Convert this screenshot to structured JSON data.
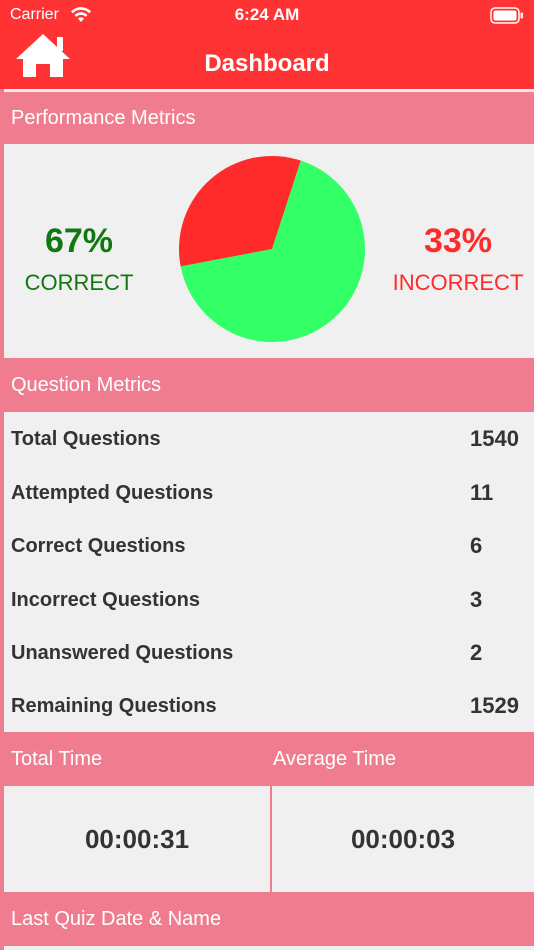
{
  "status_bar": {
    "carrier": "Carrier",
    "time": "6:24 AM"
  },
  "nav": {
    "title": "Dashboard",
    "home_icon": "home-icon"
  },
  "performance": {
    "header": "Performance Metrics",
    "correct_pct": "67%",
    "correct_label": "CORRECT",
    "incorrect_pct": "33%",
    "incorrect_label": "INCORRECT"
  },
  "question_metrics": {
    "header": "Question Metrics",
    "rows": [
      {
        "label": "Total Questions",
        "value": "1540"
      },
      {
        "label": "Attempted Questions",
        "value": "11"
      },
      {
        "label": "Correct Questions",
        "value": "6"
      },
      {
        "label": "Incorrect Questions",
        "value": "3"
      },
      {
        "label": "Unanswered Questions",
        "value": "2"
      },
      {
        "label": "Remaining Questions",
        "value": "1529"
      }
    ]
  },
  "time": {
    "total_header": "Total Time",
    "average_header": "Average Time",
    "total_value": "00:00:31",
    "average_value": "00:00:03"
  },
  "last_quiz": {
    "header": "Last Quiz Date & Name"
  },
  "chart_data": {
    "type": "pie",
    "categories": [
      "Correct",
      "Incorrect"
    ],
    "values": [
      67,
      33
    ],
    "colors": [
      "#33ff66",
      "#ff2a2a"
    ]
  },
  "colors": {
    "bar": "#ff3333",
    "section": "#f07d8f",
    "correct": "#117711",
    "incorrect": "#ff2a2a"
  }
}
